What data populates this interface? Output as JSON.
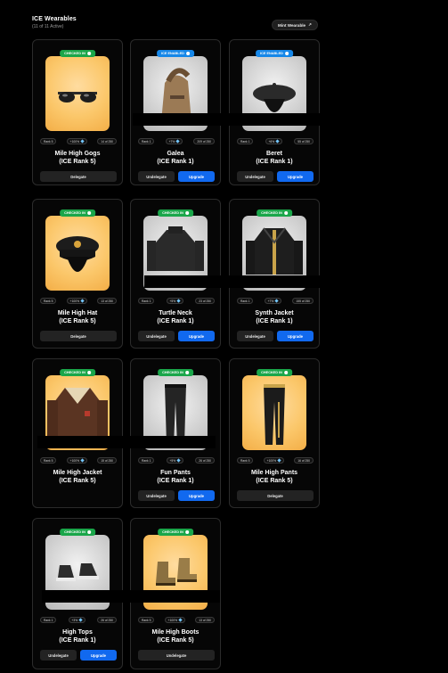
{
  "header": {
    "title": "ICE Wearables",
    "subtitle": "(11 of 11 Active)",
    "mint_button_label": "Mint Wearable",
    "mint_button_icon": "external-link-icon"
  },
  "cards": [
    {
      "badge": "CHECKED IN",
      "badge_color": "#1aa64a",
      "bg": "gold",
      "icon": "sunglasses-icon",
      "stats": [
        "Rank 5",
        "+100%",
        "14 of 250"
      ],
      "name": "Mile High Gogs",
      "rank": "(ICE Rank 5)",
      "buttons": [
        "Delegate"
      ]
    },
    {
      "badge": "ICE ENABLED",
      "badge_color": "#1687e8",
      "bg": "grey",
      "icon": "galea-helmet-icon",
      "stats": [
        "Rank 1",
        "+7%",
        "209 of 250"
      ],
      "name": "Galea",
      "rank": "(ICE Rank 1)",
      "buttons": [
        "Undelegate",
        "Upgrade"
      ]
    },
    {
      "badge": "ICE ENABLED",
      "badge_color": "#1687e8",
      "bg": "grey",
      "icon": "beret-icon",
      "stats": [
        "Rank 1",
        "+6%",
        "55 of 250"
      ],
      "name": "Beret",
      "rank": "(ICE Rank 1)",
      "buttons": [
        "Undelegate",
        "Upgrade"
      ]
    },
    {
      "badge": "CHECKED IN",
      "badge_color": "#1aa64a",
      "bg": "gold",
      "icon": "pilot-hat-icon",
      "stats": [
        "Rank 5",
        "+100%",
        "13 of 250"
      ],
      "name": "Mile High Hat",
      "rank": "(ICE Rank 5)",
      "buttons": [
        "Delegate"
      ]
    },
    {
      "badge": "CHECKED IN",
      "badge_color": "#1aa64a",
      "bg": "grey",
      "icon": "turtleneck-icon",
      "stats": [
        "Rank 1",
        "+5%",
        "23 of 250"
      ],
      "name": "Turtle Neck",
      "rank": "(ICE Rank 1)",
      "buttons": [
        "Undelegate",
        "Upgrade"
      ]
    },
    {
      "badge": "CHECKED IN",
      "badge_color": "#1aa64a",
      "bg": "grey",
      "icon": "synth-jacket-icon",
      "stats": [
        "Rank 1",
        "+7%",
        "155 of 250"
      ],
      "name": "Synth Jacket",
      "rank": "(ICE Rank 1)",
      "buttons": [
        "Undelegate",
        "Upgrade"
      ]
    },
    {
      "badge": "CHECKED IN",
      "badge_color": "#1aa64a",
      "bg": "gold",
      "icon": "bomber-jacket-icon",
      "stats": [
        "Rank 5",
        "+100%",
        "15 of 250"
      ],
      "name": "Mile High Jacket",
      "rank": "(ICE Rank 5)",
      "buttons": []
    },
    {
      "badge": "CHECKED IN",
      "badge_color": "#1aa64a",
      "bg": "grey",
      "icon": "pants-icon",
      "stats": [
        "Rank 1",
        "+5%",
        "26 of 250"
      ],
      "name": "Fun Pants",
      "rank": "(ICE Rank 1)",
      "buttons": [
        "Undelegate",
        "Upgrade"
      ]
    },
    {
      "badge": "CHECKED IN",
      "badge_color": "#1aa64a",
      "bg": "gold",
      "icon": "pilot-pants-icon",
      "stats": [
        "Rank 5",
        "+100%",
        "16 of 250"
      ],
      "name": "Mile High Pants",
      "rank": "(ICE Rank 5)",
      "buttons": [
        "Delegate"
      ]
    },
    {
      "badge": "CHECKED IN",
      "badge_color": "#1aa64a",
      "bg": "grey",
      "icon": "sneakers-icon",
      "stats": [
        "Rank 1",
        "+3%",
        "26 of 250"
      ],
      "name": "High Tops",
      "rank": "(ICE Rank 1)",
      "buttons": [
        "Undelegate",
        "Upgrade"
      ]
    },
    {
      "badge": "CHECKED IN",
      "badge_color": "#1aa64a",
      "bg": "gold",
      "icon": "boots-icon",
      "stats": [
        "Rank 5",
        "+100%",
        "13 of 250"
      ],
      "name": "Mile High Boots",
      "rank": "(ICE Rank 5)",
      "buttons": [
        "Undelegate"
      ]
    }
  ]
}
